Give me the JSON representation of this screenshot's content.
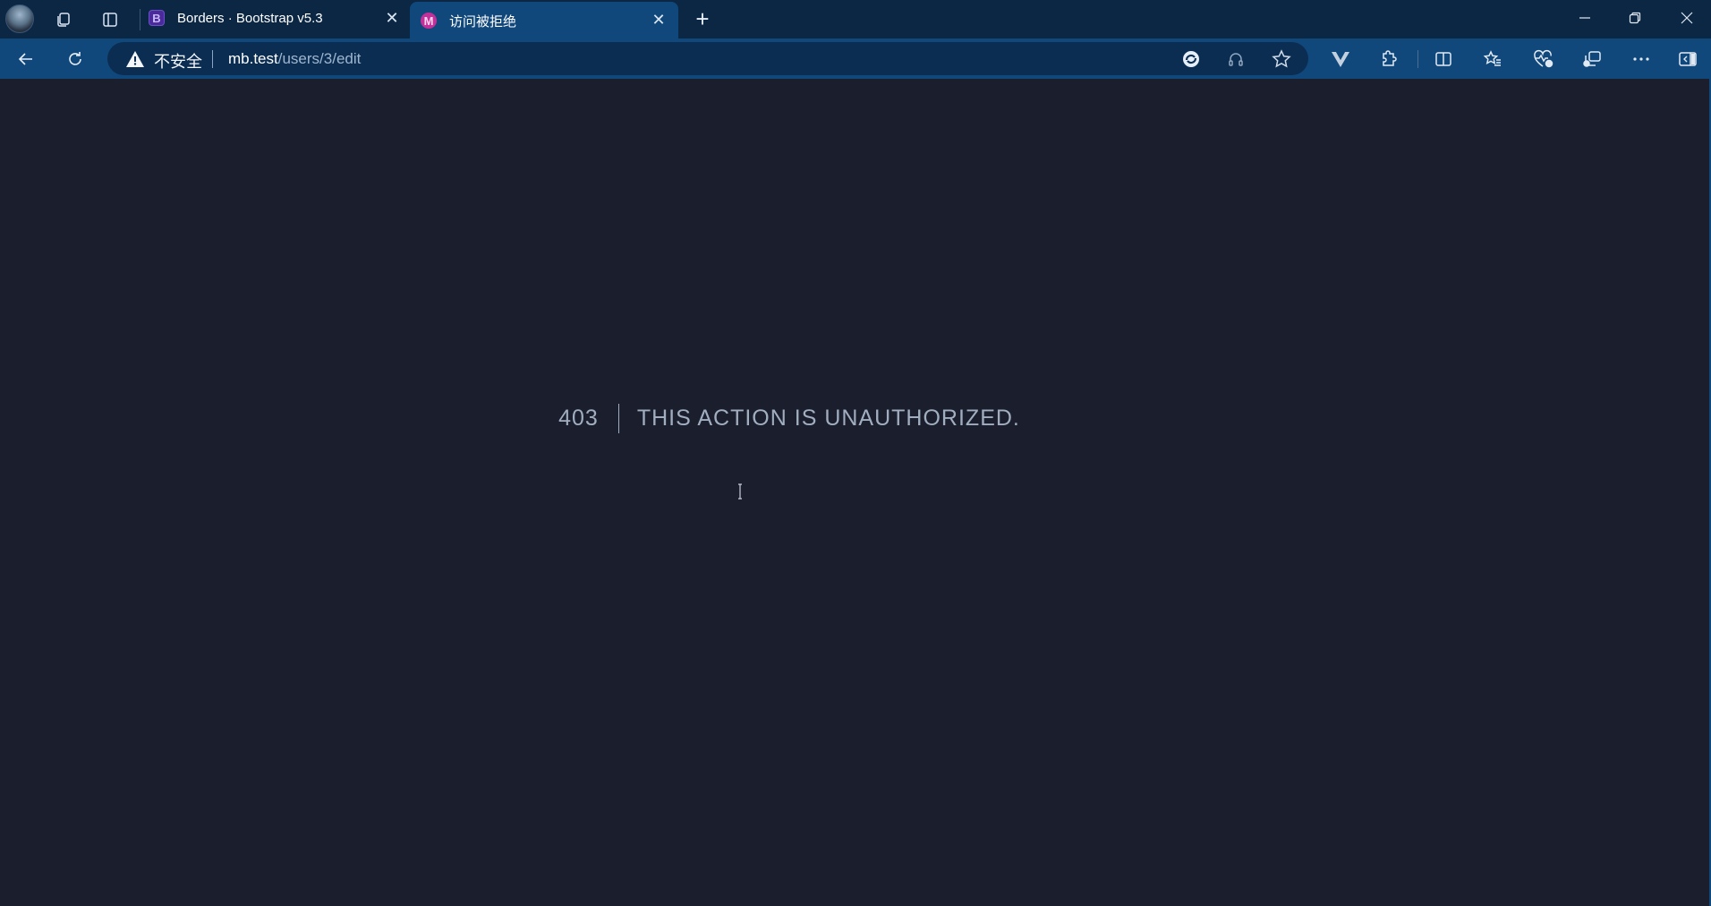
{
  "browser": {
    "tabs": [
      {
        "title": "Borders · Bootstrap v5.3",
        "favicon": "B",
        "active": false
      },
      {
        "title": "访问被拒绝",
        "favicon": "M",
        "active": true
      }
    ],
    "address_bar": {
      "security_label": "不安全",
      "url_host": "mb.test",
      "url_path": "/users/3/edit"
    },
    "icons": {
      "profile": "profile-avatar",
      "workspaces": "workspaces-icon",
      "tab_actions": "tab-actions-icon",
      "new_tab": "+",
      "minimize": "minimize-icon",
      "restore": "restore-icon",
      "close": "close-icon"
    }
  },
  "page": {
    "code": "403",
    "message": "THIS ACTION IS UNAUTHORIZED.",
    "colors": {
      "background": "#1b1e2c",
      "text": "#a0aec0"
    }
  }
}
